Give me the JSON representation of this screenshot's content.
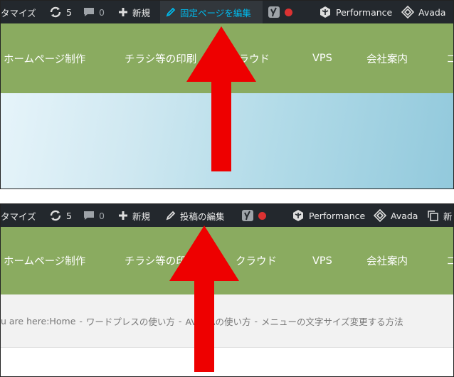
{
  "colors": {
    "admin_bar_bg": "#23282d",
    "admin_bar_text": "#eeeeee",
    "highlight_text": "#00b9eb",
    "nav_bg": "#8aab60",
    "arrow_red": "#ee0000",
    "status_dot": "#dc3232"
  },
  "top_panel": {
    "admin_bar": {
      "customize": "タマイズ",
      "updates_count": "5",
      "comments_count": "0",
      "new_label": "新規",
      "edit_label": "固定ページを編集",
      "performance_label": "Performance",
      "avada_label": "Avada"
    },
    "nav": {
      "items": [
        "ホームページ制作",
        "チラシ等の印刷",
        "クラウド",
        "VPS",
        "会社案内",
        "コ"
      ]
    }
  },
  "bottom_panel": {
    "admin_bar": {
      "customize": "タマイズ",
      "updates_count": "5",
      "comments_count": "0",
      "new_label": "新規",
      "edit_label": "投稿の編集",
      "performance_label": "Performance",
      "avada_label": "Avada",
      "duplicate_label": "新"
    },
    "nav": {
      "items": [
        "ホームページ制作",
        "チラシ等の印刷",
        "クラウド",
        "VPS",
        "会社案内",
        "コ"
      ]
    },
    "breadcrumb": {
      "prefix": "u are here: ",
      "items": [
        "Home",
        "ワードプレスの使い方",
        "AVADAの使い方",
        "メニューの文字サイズ変更する方法"
      ],
      "separator": "-"
    }
  }
}
